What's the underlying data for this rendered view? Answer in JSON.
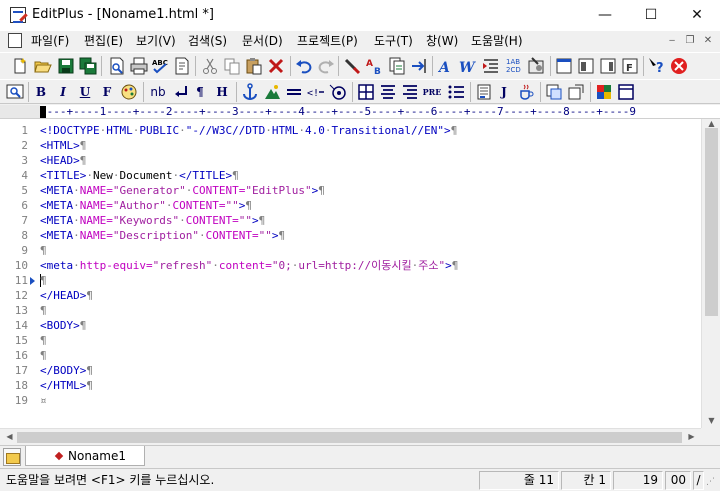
{
  "window": {
    "title": "EditPlus - [Noname1.html *]",
    "controls": {
      "minimize": "—",
      "maximize": "☐",
      "close": "✕"
    }
  },
  "menu": {
    "items": [
      "파일(F)",
      "편집(E)",
      "보기(V)",
      "검색(S)",
      "문서(D)",
      "프로젝트(P)",
      "도구(T)",
      "창(W)",
      "도움말(H)"
    ],
    "mdi_controls": [
      "‒",
      "❐",
      "✕"
    ]
  },
  "toolbar1": {
    "icons": [
      "new-file-icon",
      "open-folder-icon",
      "save-icon",
      "save-all-icon",
      "print-preview-icon",
      "print-icon",
      "spell-check-icon",
      "ftp-icon",
      "cut-icon",
      "copy-icon",
      "paste-icon",
      "delete-icon",
      "undo-icon",
      "redo-icon",
      "find-icon",
      "replace-icon",
      "find-in-files-icon",
      "goto-icon",
      "font-icon",
      "word-wrap-icon",
      "indent-icon",
      "column-select-icon",
      "settings-icon",
      "screen-icon",
      "cliptext-icon",
      "directory-icon",
      "browser-icon",
      "help-icon",
      "stop-icon"
    ]
  },
  "toolbar2": {
    "labels": {
      "bold": "B",
      "italic": "I",
      "underline": "U",
      "font": "F",
      "nbsp": "nb",
      "pre": "PRE",
      "heading": "H",
      "paragraph": "¶",
      "javascript": "J"
    }
  },
  "ruler": {
    "text": "----+----1----+----2----+----3----+----4----+----5----+----6----+----7----+----8----+----9"
  },
  "editor": {
    "current_line": 11,
    "lines": [
      {
        "n": "1",
        "segs": [
          [
            "t",
            "<!DOCTYPE"
          ],
          [
            "p",
            "·"
          ],
          [
            "t",
            "HTML"
          ],
          [
            "p",
            "·"
          ],
          [
            "t",
            "PUBLIC"
          ],
          [
            "p",
            "·"
          ],
          [
            "t",
            "\"-//W3C//DTD"
          ],
          [
            "p",
            "·"
          ],
          [
            "t",
            "HTML"
          ],
          [
            "p",
            "·"
          ],
          [
            "t",
            "4.0"
          ],
          [
            "p",
            "·"
          ],
          [
            "t",
            "Transitional//EN\">"
          ],
          [
            "p",
            "¶"
          ]
        ]
      },
      {
        "n": "2",
        "segs": [
          [
            "t",
            "<HTML>"
          ],
          [
            "p",
            "¶"
          ]
        ]
      },
      {
        "n": "3",
        "segs": [
          [
            "t",
            "<HEAD>"
          ],
          [
            "p",
            "¶"
          ]
        ]
      },
      {
        "n": "4",
        "segs": [
          [
            "t",
            "<TITLE>"
          ],
          [
            "p",
            "·"
          ],
          [
            "d",
            "New"
          ],
          [
            "p",
            "·"
          ],
          [
            "d",
            "Document"
          ],
          [
            "p",
            "·"
          ],
          [
            "t",
            "</TITLE>"
          ],
          [
            "p",
            "¶"
          ]
        ]
      },
      {
        "n": "5",
        "segs": [
          [
            "t",
            "<META"
          ],
          [
            "p",
            "·"
          ],
          [
            "a",
            "NAME="
          ],
          [
            "s",
            "\"Generator\""
          ],
          [
            "p",
            "·"
          ],
          [
            "a",
            "CONTENT="
          ],
          [
            "s",
            "\"EditPlus\""
          ],
          [
            "t",
            ">"
          ],
          [
            "p",
            "¶"
          ]
        ]
      },
      {
        "n": "6",
        "segs": [
          [
            "t",
            "<META"
          ],
          [
            "p",
            "·"
          ],
          [
            "a",
            "NAME="
          ],
          [
            "s",
            "\"Author\""
          ],
          [
            "p",
            "·"
          ],
          [
            "a",
            "CONTENT="
          ],
          [
            "s",
            "\"\""
          ],
          [
            "t",
            ">"
          ],
          [
            "p",
            "¶"
          ]
        ]
      },
      {
        "n": "7",
        "segs": [
          [
            "t",
            "<META"
          ],
          [
            "p",
            "·"
          ],
          [
            "a",
            "NAME="
          ],
          [
            "s",
            "\"Keywords\""
          ],
          [
            "p",
            "·"
          ],
          [
            "a",
            "CONTENT="
          ],
          [
            "s",
            "\"\""
          ],
          [
            "t",
            ">"
          ],
          [
            "p",
            "¶"
          ]
        ]
      },
      {
        "n": "8",
        "segs": [
          [
            "t",
            "<META"
          ],
          [
            "p",
            "·"
          ],
          [
            "a",
            "NAME="
          ],
          [
            "s",
            "\"Description\""
          ],
          [
            "p",
            "·"
          ],
          [
            "a",
            "CONTENT="
          ],
          [
            "s",
            "\"\""
          ],
          [
            "t",
            ">"
          ],
          [
            "p",
            "¶"
          ]
        ]
      },
      {
        "n": "9",
        "segs": [
          [
            "p",
            "¶"
          ]
        ]
      },
      {
        "n": "10",
        "segs": [
          [
            "t",
            "<meta"
          ],
          [
            "p",
            "·"
          ],
          [
            "a",
            "http-equiv="
          ],
          [
            "s",
            "\"refresh\""
          ],
          [
            "p",
            "·"
          ],
          [
            "a",
            "content="
          ],
          [
            "s",
            "\"0;"
          ],
          [
            "p",
            "·"
          ],
          [
            "s",
            "url=http://이동시킬"
          ],
          [
            "p",
            "·"
          ],
          [
            "s",
            "주소\""
          ],
          [
            "t",
            ">"
          ],
          [
            "p",
            "¶"
          ]
        ]
      },
      {
        "n": "11",
        "segs": [
          [
            "p",
            "¶"
          ]
        ]
      },
      {
        "n": "12",
        "segs": [
          [
            "t",
            "</HEAD>"
          ],
          [
            "p",
            "¶"
          ]
        ]
      },
      {
        "n": "13",
        "segs": [
          [
            "p",
            "¶"
          ]
        ]
      },
      {
        "n": "14",
        "segs": [
          [
            "t",
            "<BODY>"
          ],
          [
            "p",
            "¶"
          ]
        ]
      },
      {
        "n": "15",
        "segs": [
          [
            "p",
            "¶"
          ]
        ]
      },
      {
        "n": "16",
        "segs": [
          [
            "p",
            "¶"
          ]
        ]
      },
      {
        "n": "17",
        "segs": [
          [
            "t",
            "</BODY>"
          ],
          [
            "p",
            "¶"
          ]
        ]
      },
      {
        "n": "18",
        "segs": [
          [
            "t",
            "</HTML>"
          ],
          [
            "p",
            "¶"
          ]
        ]
      },
      {
        "n": "19",
        "segs": [
          [
            "p",
            "¤"
          ]
        ]
      }
    ]
  },
  "tabs": [
    {
      "label": "Noname1"
    }
  ],
  "status": {
    "help": "도움말을 보려면 <F1> 키를 누르십시오.",
    "line": "줄 11",
    "col": "칸 1",
    "total": "19",
    "code": "00",
    "mode": "/"
  }
}
